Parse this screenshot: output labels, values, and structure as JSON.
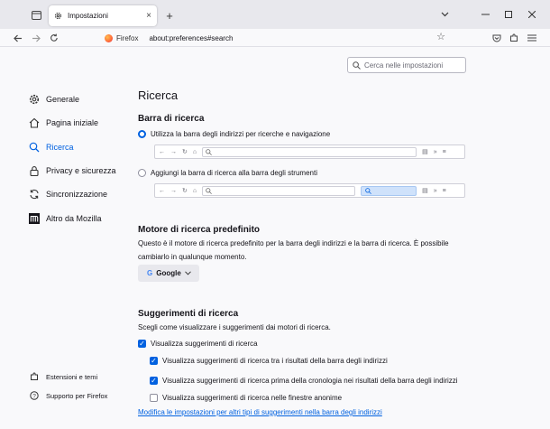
{
  "tab": {
    "title": "Impostazioni"
  },
  "urlbar": {
    "identity": "Firefox",
    "url": "about:preferences#search"
  },
  "search": {
    "placeholder": "Cerca nelle impostazioni"
  },
  "sidebar": {
    "items": [
      {
        "label": "Generale",
        "icon": "gear-icon"
      },
      {
        "label": "Pagina iniziale",
        "icon": "home-icon"
      },
      {
        "label": "Ricerca",
        "icon": "search-icon",
        "active": true
      },
      {
        "label": "Privacy e sicurezza",
        "icon": "lock-icon"
      },
      {
        "label": "Sincronizzazione",
        "icon": "sync-icon"
      },
      {
        "label": "Altro da Mozilla",
        "icon": "mozilla-icon"
      }
    ],
    "extensions": "Estensioni e temi",
    "support": "Supporto per Firefox"
  },
  "main": {
    "title": "Ricerca",
    "searchbar": {
      "heading": "Barra di ricerca",
      "option1": "Utilizza la barra degli indirizzi per ricerche e navigazione",
      "option2": "Aggiungi la barra di ricerca alla barra degli strumenti",
      "selected": "option1"
    },
    "engine": {
      "heading": "Motore di ricerca predefinito",
      "description": "Questo è il motore di ricerca predefinito per la barra degli indirizzi e la barra di ricerca. È possibile cambiarlo in qualunque momento.",
      "selected": "Google"
    },
    "suggestions": {
      "heading": "Suggerimenti di ricerca",
      "description": "Scegli come visualizzare i suggerimenti dai motori di ricerca.",
      "show": {
        "label": "Visualizza suggerimenti di ricerca",
        "checked": true
      },
      "in_urlbar": {
        "label": "Visualizza suggerimenti di ricerca tra i risultati della barra degli indirizzi",
        "checked": true
      },
      "before_history": {
        "label": "Visualizza suggerimenti di ricerca prima della cronologia nei risultati della barra degli indirizzi",
        "checked": true
      },
      "private": {
        "label": "Visualizza suggerimenti di ricerca nelle finestre anonime",
        "checked": false
      },
      "link": "Modifica le impostazioni per altri tipi di suggerimenti nella barra degli indirizzi"
    }
  },
  "colors": {
    "accent": "#0061e0",
    "background": "#f9f9fb",
    "tabstrip": "#e8e8ed"
  }
}
